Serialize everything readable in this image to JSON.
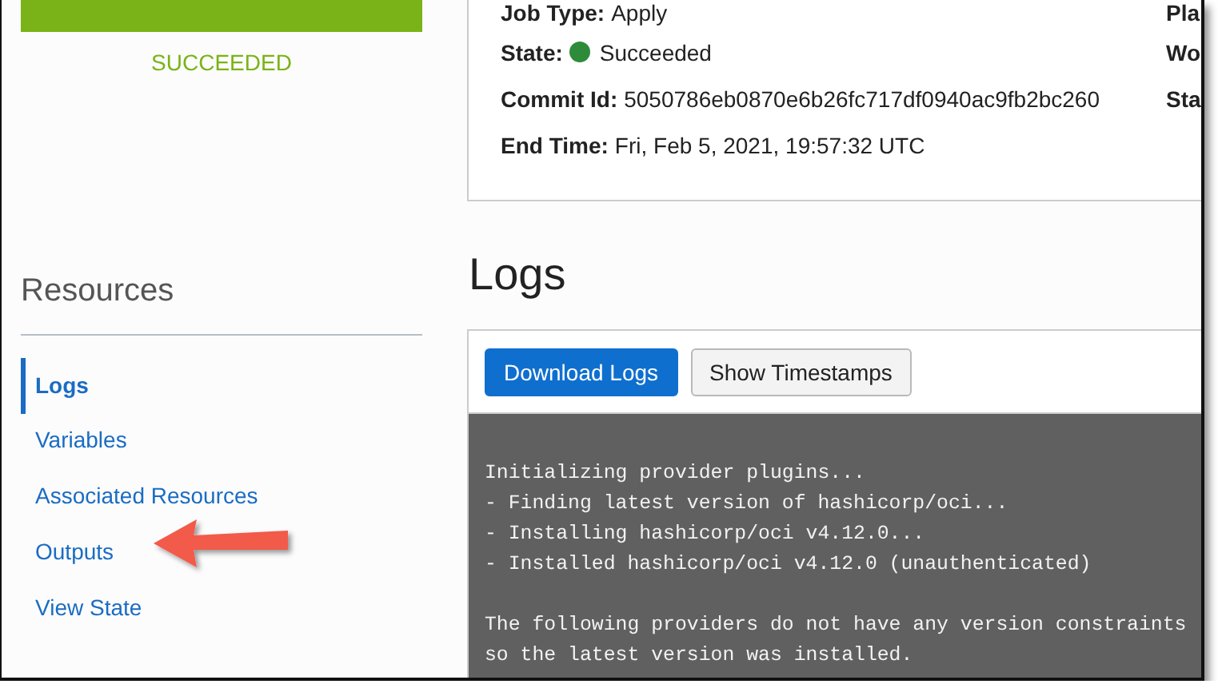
{
  "status": {
    "label": "SUCCEEDED"
  },
  "details": {
    "fields": [
      {
        "label": "Job Type:",
        "value": "Apply",
        "kind": "text"
      },
      {
        "label": "State:",
        "value": "Succeeded",
        "kind": "status"
      },
      {
        "label": "Commit Id:",
        "value": "5050786eb0870e6b26fc717df0940ac9fb2bc260",
        "kind": "text"
      },
      {
        "label": "End Time:",
        "value": "Fri, Feb 5, 2021, 19:57:32 UTC",
        "kind": "text"
      }
    ],
    "column_2_labels": [
      "Pla",
      "Wo",
      "Sta"
    ]
  },
  "sidebar": {
    "title": "Resources",
    "items": [
      {
        "label": "Logs",
        "selected": true
      },
      {
        "label": "Variables",
        "selected": false
      },
      {
        "label": "Associated Resources",
        "selected": false
      },
      {
        "label": "Outputs",
        "selected": false
      },
      {
        "label": "View State",
        "selected": false
      }
    ]
  },
  "logs": {
    "title": "Logs",
    "buttons": [
      {
        "label": "Download Logs",
        "kind": "primary"
      },
      {
        "label": "Show Timestamps",
        "kind": "secondary"
      }
    ],
    "blocks": [
      [
        "Initializing provider plugins...",
        "- Finding latest version of hashicorp/oci...",
        "- Installing hashicorp/oci v4.12.0...",
        "- Installed hashicorp/oci v4.12.0 (unauthenticated)"
      ],
      [
        "The following providers do not have any version constraints",
        "so the latest version was installed."
      ]
    ]
  }
}
